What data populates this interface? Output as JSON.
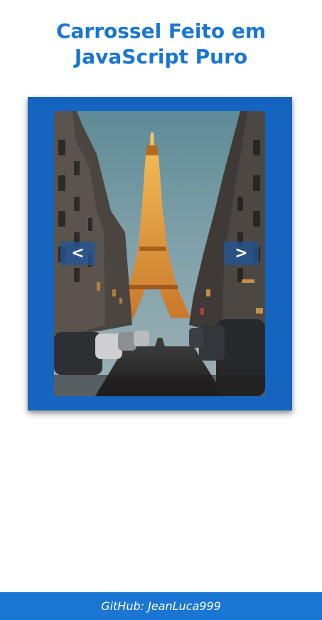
{
  "header": {
    "title_line1": "Carrossel Feito em",
    "title_line2": "JavaScript Puro"
  },
  "carousel": {
    "prev_label": "<",
    "next_label": ">",
    "slide": {
      "subject": "eiffel-tower-street-night-photo"
    }
  },
  "footer": {
    "text": "GitHub: JeanLuca999"
  },
  "colors": {
    "accent": "#1976d2",
    "frame": "#1565c0",
    "footer": "#1976d2"
  }
}
